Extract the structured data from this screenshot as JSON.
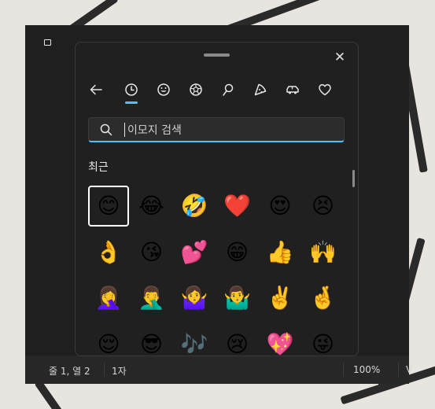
{
  "window": {
    "status_position": "줄 1, 열 2",
    "status_chars": "1자",
    "status_zoom": "100%",
    "status_extra": "V"
  },
  "emoji_panel": {
    "close_glyph": "✕",
    "tabs": [
      {
        "name": "back",
        "icon": "back-arrow-icon",
        "active": false
      },
      {
        "name": "recent",
        "icon": "clock-icon",
        "active": true
      },
      {
        "name": "smileys",
        "icon": "smiley-icon",
        "active": false
      },
      {
        "name": "people",
        "icon": "ball-icon",
        "active": false
      },
      {
        "name": "activities",
        "icon": "pin-icon",
        "active": false
      },
      {
        "name": "food",
        "icon": "pizza-icon",
        "active": false
      },
      {
        "name": "travel",
        "icon": "car-icon",
        "active": false
      },
      {
        "name": "symbols",
        "icon": "heart-icon",
        "active": false
      }
    ],
    "search": {
      "value": "",
      "placeholder": "이모지 검색"
    },
    "section_title": "최근",
    "emojis": [
      "😊",
      "😂",
      "🤣",
      "❤️",
      "😍",
      "😣",
      "👌",
      "😘",
      "💕",
      "😁",
      "👍",
      "🙌",
      "🤦‍♀️",
      "🤦‍♂️",
      "🤷‍♀️",
      "🤷‍♂️",
      "✌️",
      "🤞",
      "😌",
      "😎",
      "🎶",
      "😢",
      "💖",
      "😜"
    ],
    "selected_index": 0
  },
  "colors": {
    "accent": "#4cc2ff",
    "panel_bg": "#202020"
  }
}
